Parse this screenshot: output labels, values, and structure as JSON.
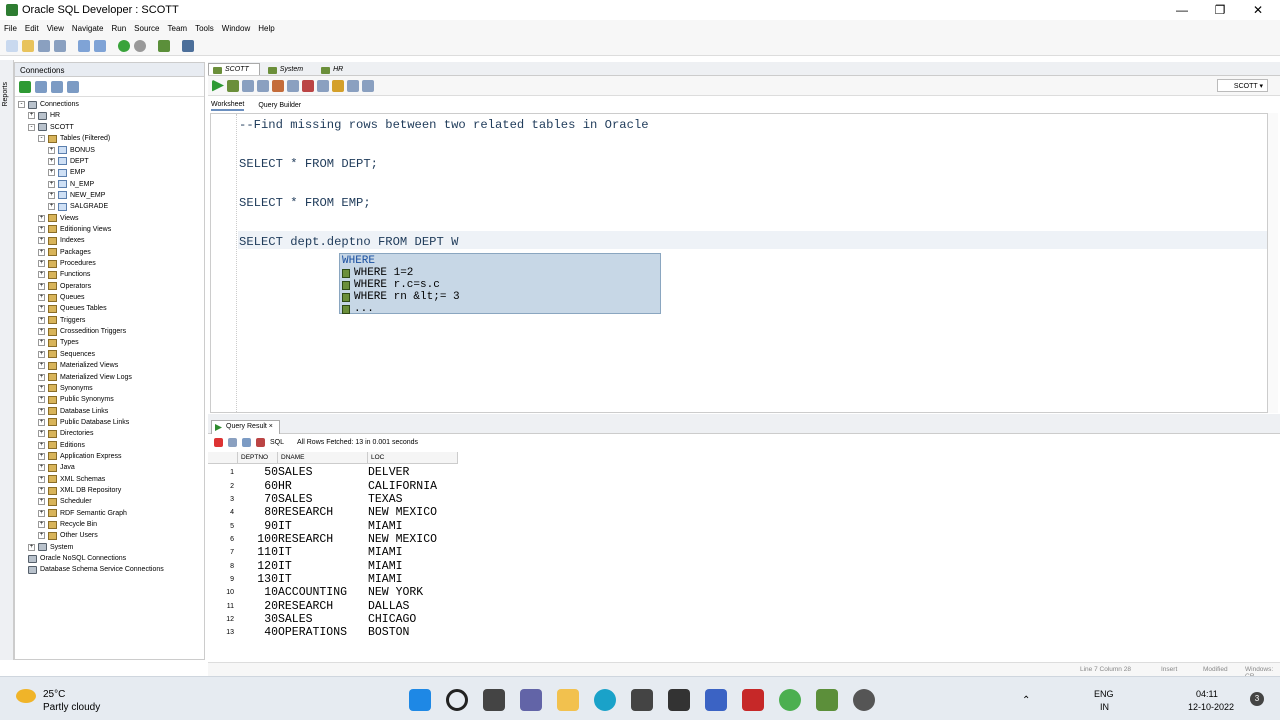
{
  "window": {
    "title": "Oracle SQL Developer : SCOTT",
    "min": "—",
    "max": "❐",
    "close": "✕"
  },
  "menu": [
    "File",
    "Edit",
    "View",
    "Navigate",
    "Run",
    "Source",
    "Team",
    "Tools",
    "Window",
    "Help"
  ],
  "sidebar": {
    "strip_label": "Reports",
    "header": "Connections",
    "tree": [
      {
        "label": "Connections",
        "level": 0,
        "exp": "-",
        "icon": "db"
      },
      {
        "label": "HR",
        "level": 1,
        "exp": "+",
        "icon": "db"
      },
      {
        "label": "SCOTT",
        "level": 1,
        "exp": "-",
        "icon": "db"
      },
      {
        "label": "Tables (Filtered)",
        "level": 2,
        "exp": "-",
        "icon": "folder"
      },
      {
        "label": "BONUS",
        "level": 3,
        "exp": "+",
        "icon": "tbl"
      },
      {
        "label": "DEPT",
        "level": 3,
        "exp": "+",
        "icon": "tbl"
      },
      {
        "label": "EMP",
        "level": 3,
        "exp": "+",
        "icon": "tbl"
      },
      {
        "label": "N_EMP",
        "level": 3,
        "exp": "+",
        "icon": "tbl"
      },
      {
        "label": "NEW_EMP",
        "level": 3,
        "exp": "+",
        "icon": "tbl"
      },
      {
        "label": "SALGRADE",
        "level": 3,
        "exp": "+",
        "icon": "tbl"
      },
      {
        "label": "Views",
        "level": 2,
        "exp": "+",
        "icon": "folder"
      },
      {
        "label": "Editioning Views",
        "level": 2,
        "exp": "+",
        "icon": "folder"
      },
      {
        "label": "Indexes",
        "level": 2,
        "exp": "+",
        "icon": "folder"
      },
      {
        "label": "Packages",
        "level": 2,
        "exp": "+",
        "icon": "folder"
      },
      {
        "label": "Procedures",
        "level": 2,
        "exp": "+",
        "icon": "folder"
      },
      {
        "label": "Functions",
        "level": 2,
        "exp": "+",
        "icon": "folder"
      },
      {
        "label": "Operators",
        "level": 2,
        "exp": "+",
        "icon": "folder"
      },
      {
        "label": "Queues",
        "level": 2,
        "exp": "+",
        "icon": "folder"
      },
      {
        "label": "Queues Tables",
        "level": 2,
        "exp": "+",
        "icon": "folder"
      },
      {
        "label": "Triggers",
        "level": 2,
        "exp": "+",
        "icon": "folder"
      },
      {
        "label": "Crossedition Triggers",
        "level": 2,
        "exp": "+",
        "icon": "folder"
      },
      {
        "label": "Types",
        "level": 2,
        "exp": "+",
        "icon": "folder"
      },
      {
        "label": "Sequences",
        "level": 2,
        "exp": "+",
        "icon": "folder"
      },
      {
        "label": "Materialized Views",
        "level": 2,
        "exp": "+",
        "icon": "folder"
      },
      {
        "label": "Materialized View Logs",
        "level": 2,
        "exp": "+",
        "icon": "folder"
      },
      {
        "label": "Synonyms",
        "level": 2,
        "exp": "+",
        "icon": "folder"
      },
      {
        "label": "Public Synonyms",
        "level": 2,
        "exp": "+",
        "icon": "folder"
      },
      {
        "label": "Database Links",
        "level": 2,
        "exp": "+",
        "icon": "folder"
      },
      {
        "label": "Public Database Links",
        "level": 2,
        "exp": "+",
        "icon": "folder"
      },
      {
        "label": "Directories",
        "level": 2,
        "exp": "+",
        "icon": "folder"
      },
      {
        "label": "Editions",
        "level": 2,
        "exp": "+",
        "icon": "folder"
      },
      {
        "label": "Application Express",
        "level": 2,
        "exp": "+",
        "icon": "folder"
      },
      {
        "label": "Java",
        "level": 2,
        "exp": "+",
        "icon": "folder"
      },
      {
        "label": "XML Schemas",
        "level": 2,
        "exp": "+",
        "icon": "folder"
      },
      {
        "label": "XML DB Repository",
        "level": 2,
        "exp": "+",
        "icon": "folder"
      },
      {
        "label": "Scheduler",
        "level": 2,
        "exp": "+",
        "icon": "folder"
      },
      {
        "label": "RDF Semantic Graph",
        "level": 2,
        "exp": "+",
        "icon": "folder"
      },
      {
        "label": "Recycle Bin",
        "level": 2,
        "exp": "+",
        "icon": "folder"
      },
      {
        "label": "Other Users",
        "level": 2,
        "exp": "+",
        "icon": "folder"
      },
      {
        "label": "System",
        "level": 1,
        "exp": "+",
        "icon": "db"
      },
      {
        "label": "Oracle NoSQL Connections",
        "level": 0,
        "exp": "",
        "icon": "db"
      },
      {
        "label": "Database Schema Service Connections",
        "level": 0,
        "exp": "",
        "icon": "db"
      }
    ]
  },
  "editor": {
    "tabs": [
      "SCOTT",
      "System",
      "HR"
    ],
    "connection": "SCOTT",
    "subtabs": [
      "Worksheet",
      "Query Builder"
    ],
    "lines": [
      "--Find missing rows between two related tables in Oracle",
      "SELECT * FROM DEPT;",
      "SELECT * FROM EMP;",
      "SELECT dept.deptno FROM DEPT W"
    ],
    "autocomplete": [
      "WHERE",
      "WHERE 1=2",
      "WHERE r.c=s.c",
      "WHERE rn &lt;= 3",
      " ..."
    ]
  },
  "results": {
    "tab": "Query Result",
    "sql_label": "SQL",
    "status": "All Rows Fetched: 13 in 0.001 seconds",
    "columns": [
      "DEPTNO",
      "DNAME",
      "LOC"
    ],
    "rows": [
      [
        "1",
        "50",
        "SALES",
        "DELVER"
      ],
      [
        "2",
        "60",
        "HR",
        "CALIFORNIA"
      ],
      [
        "3",
        "70",
        "SALES",
        "TEXAS"
      ],
      [
        "4",
        "80",
        "RESEARCH",
        "NEW MEXICO"
      ],
      [
        "5",
        "90",
        "IT",
        "MIAMI"
      ],
      [
        "6",
        "100",
        "RESEARCH",
        "NEW MEXICO"
      ],
      [
        "7",
        "110",
        "IT",
        "MIAMI"
      ],
      [
        "8",
        "120",
        "IT",
        "MIAMI"
      ],
      [
        "9",
        "130",
        "IT",
        "MIAMI"
      ],
      [
        "10",
        "10",
        "ACCOUNTING",
        "NEW YORK"
      ],
      [
        "11",
        "20",
        "RESEARCH",
        "DALLAS"
      ],
      [
        "12",
        "30",
        "SALES",
        "CHICAGO"
      ],
      [
        "13",
        "40",
        "OPERATIONS",
        "BOSTON"
      ]
    ]
  },
  "statusbar": {
    "position": "Line 7 Column 28",
    "mode": "Insert",
    "modified": "Modified",
    "os": "Windows: CR"
  },
  "taskbar": {
    "temperature": "25°C",
    "weather": "Partly cloudy",
    "lang1": "ENG",
    "lang2": "IN",
    "time": "04:11",
    "date": "12-10-2022",
    "notifications": "3"
  }
}
